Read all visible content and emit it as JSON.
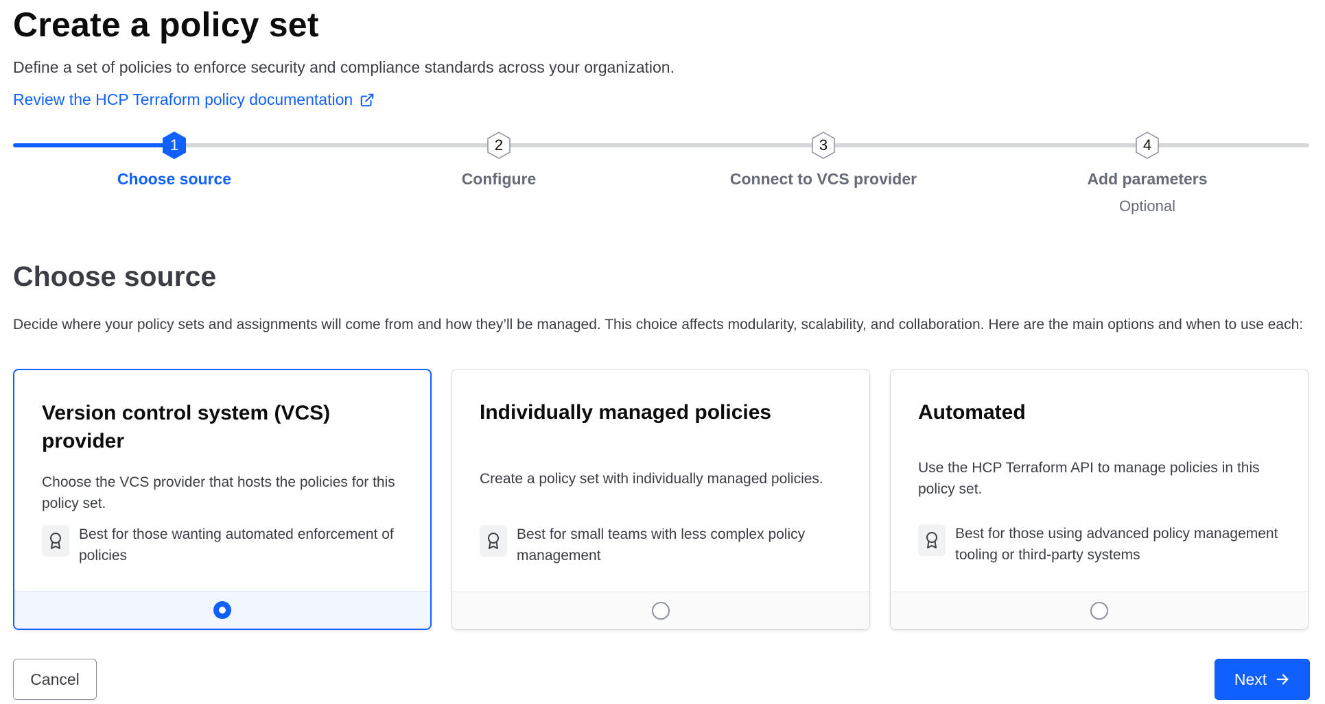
{
  "header": {
    "title": "Create a policy set",
    "description": "Define a set of policies to enforce security and compliance standards across your organization.",
    "doc_link": "Review the HCP Terraform policy documentation"
  },
  "stepper": {
    "current_step": 1,
    "steps": [
      {
        "number": "1",
        "label": "Choose source",
        "sublabel": ""
      },
      {
        "number": "2",
        "label": "Configure",
        "sublabel": ""
      },
      {
        "number": "3",
        "label": "Connect to VCS provider",
        "sublabel": ""
      },
      {
        "number": "4",
        "label": "Add parameters",
        "sublabel": "Optional"
      }
    ]
  },
  "section": {
    "title": "Choose source",
    "description": "Decide where your policy sets and assignments will come from and how they’ll be managed. This choice affects modularity, scalability, and collaboration. Here are the main options and when to use each:"
  },
  "options": [
    {
      "title": "Version control system (VCS) provider",
      "description": "Choose the VCS provider that hosts the policies for this policy set.",
      "benefit": "Best for those wanting automated enforcement of policies",
      "selected": true
    },
    {
      "title": "Individually managed policies",
      "description": "Create a policy set with individually managed policies.",
      "benefit": "Best for small teams with less complex policy management",
      "selected": false
    },
    {
      "title": "Automated",
      "description": "Use the HCP Terraform API to manage policies in this policy set.",
      "benefit": "Best for those using advanced policy management tooling or third-party systems",
      "selected": false
    }
  ],
  "actions": {
    "cancel": "Cancel",
    "next": "Next"
  },
  "colors": {
    "accent": "#1060ff",
    "text_strong": "#0c0c0e",
    "text": "#3b3d45",
    "muted": "#656a76",
    "track": "#d5d7db"
  },
  "icons": {
    "doc_link": "external-link-icon",
    "benefit": "award-icon",
    "next": "arrow-right-icon"
  }
}
